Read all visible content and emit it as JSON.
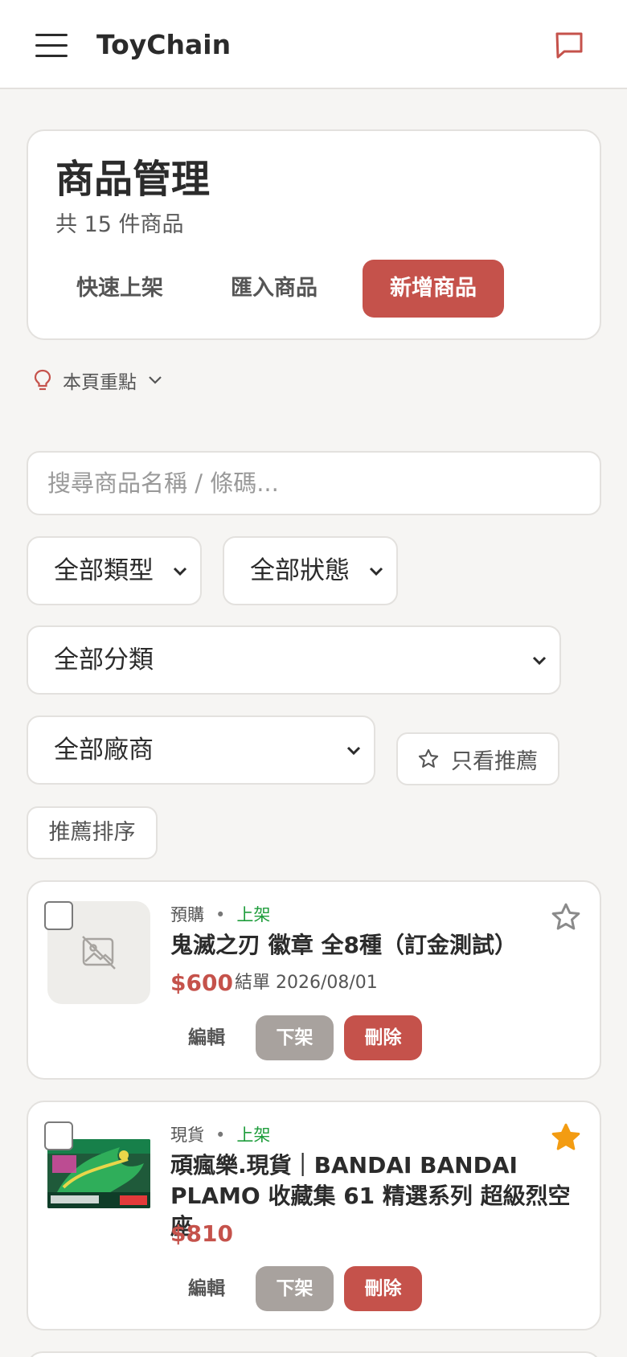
{
  "app": {
    "brand": "ToyChain"
  },
  "header": {
    "title": "商品管理",
    "subtitle": "共 15 件商品",
    "quick_label": "快速上架",
    "import_label": "匯入商品",
    "add_label": "新增商品"
  },
  "tips": {
    "label": "本頁重點"
  },
  "search": {
    "placeholder": "搜尋商品名稱 / 條碼..."
  },
  "filters": {
    "type": "全部類型",
    "status": "全部狀態",
    "category": "全部分類",
    "vendor": "全部廠商",
    "recommended_only": "只看推薦",
    "sort": "推薦排序"
  },
  "colors": {
    "accent": "#c5524b",
    "listed": "#1f9d3c",
    "unlist_button": "#a8a29e",
    "star_active": "#f39c12"
  },
  "products": [
    {
      "type": "預購",
      "dot": "•",
      "status": "上架",
      "title": "鬼滅之刃 徽章 全8種（訂金測試）",
      "price": "$600",
      "close_date": "結單 2026/08/01",
      "recommended": false,
      "image": "no-image-icon",
      "edit": "編輯",
      "unlist": "下架",
      "delete": "刪除"
    },
    {
      "type": "現貨",
      "dot": "•",
      "status": "上架",
      "title": "頑瘋樂.現貨｜BANDAI BANDAI PLAMO 收藏集 61 精選系列 超級烈空座",
      "price": "$810",
      "recommended": true,
      "image": "product-box-art",
      "edit": "編輯",
      "unlist": "下架",
      "delete": "刪除"
    }
  ]
}
